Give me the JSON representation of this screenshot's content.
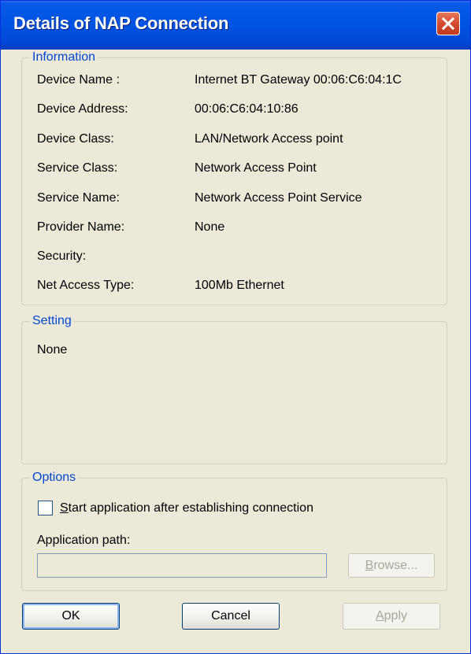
{
  "window": {
    "title": "Details of NAP Connection",
    "accent_color": "#0054e3",
    "close_button_color": "#d3462b"
  },
  "information": {
    "legend": "Information",
    "rows": [
      {
        "label": "Device Name :",
        "value": "Internet BT Gateway  00:06:C6:04:1C"
      },
      {
        "label": "Device Address:",
        "value": "00:06:C6:04:10:86"
      },
      {
        "label": "Device Class:",
        "value": "LAN/Network Access point"
      },
      {
        "label": "Service Class:",
        "value": "Network Access Point"
      },
      {
        "label": "Service Name:",
        "value": "Network Access Point Service"
      },
      {
        "label": "Provider Name:",
        "value": "None"
      },
      {
        "label": "Security:",
        "value": ""
      },
      {
        "label": "Net Access Type:",
        "value": "100Mb Ethernet"
      }
    ]
  },
  "setting": {
    "legend": "Setting",
    "value": "None"
  },
  "options": {
    "legend": "Options",
    "checkbox_mnemonic": "S",
    "checkbox_rest": "tart application after establishing connection",
    "checkbox_checked": false,
    "path_label": "Application path:",
    "path_value": "",
    "browse_mnemonic": "B",
    "browse_rest": "rowse..."
  },
  "buttons": {
    "ok": "OK",
    "cancel": "Cancel",
    "apply_mnemonic": "A",
    "apply_rest": "pply"
  }
}
